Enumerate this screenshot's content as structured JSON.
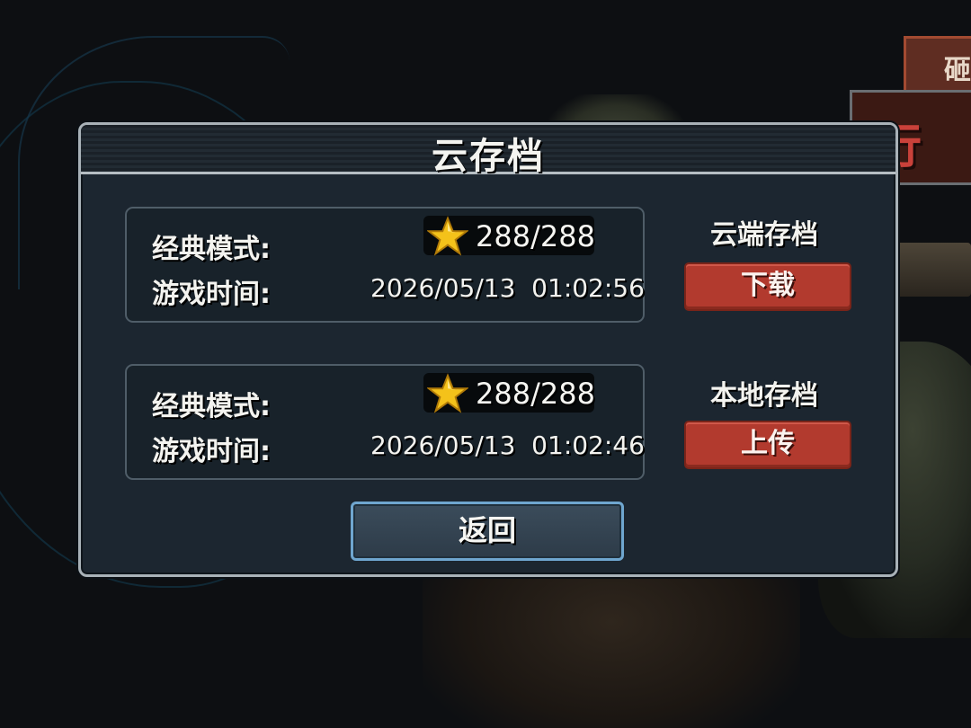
{
  "background": {
    "sign_text": "砸",
    "banner_text": "行"
  },
  "dialog": {
    "title": "云存档",
    "cloud": {
      "mode_label": "经典模式:",
      "time_label": "游戏时间:",
      "stars": "288/288",
      "timestamp": "2026/05/13  01:02:56",
      "side_label": "云端存档",
      "button": "下载"
    },
    "local": {
      "mode_label": "经典模式:",
      "time_label": "游戏时间:",
      "stars": "288/288",
      "timestamp": "2026/05/13  01:02:46",
      "side_label": "本地存档",
      "button": "上传"
    },
    "back_button": "返回"
  },
  "colors": {
    "panel": "#1c2630",
    "button_red": "#b23a2e",
    "button_blue_border": "#6fa6cf",
    "star": "#f4c21a"
  },
  "icons": [
    "star-icon"
  ]
}
